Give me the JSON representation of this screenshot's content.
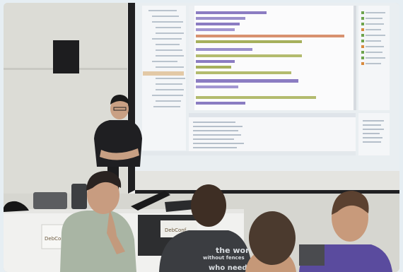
{
  "scene": {
    "description_label": "presentation-room-photo",
    "colors": {
      "frame": "#e6eef3",
      "wall": "#d7d7d2",
      "screen": "#ecf0f2",
      "screen_shadow": "#cfd6db",
      "presenter_shirt": "#1f1f22",
      "table_cloth": "#f3f3f1",
      "accent_code_purple": "#7b68b5",
      "accent_code_olive": "#9ca64d",
      "accent_code_salmon": "#d78b6b"
    },
    "logos": {
      "table_logo_text": "DebConf",
      "laptop_logo_text": "DebConf"
    },
    "shirt_text": {
      "line1": "the world",
      "line2": "without fences",
      "line3": "who needs"
    }
  }
}
